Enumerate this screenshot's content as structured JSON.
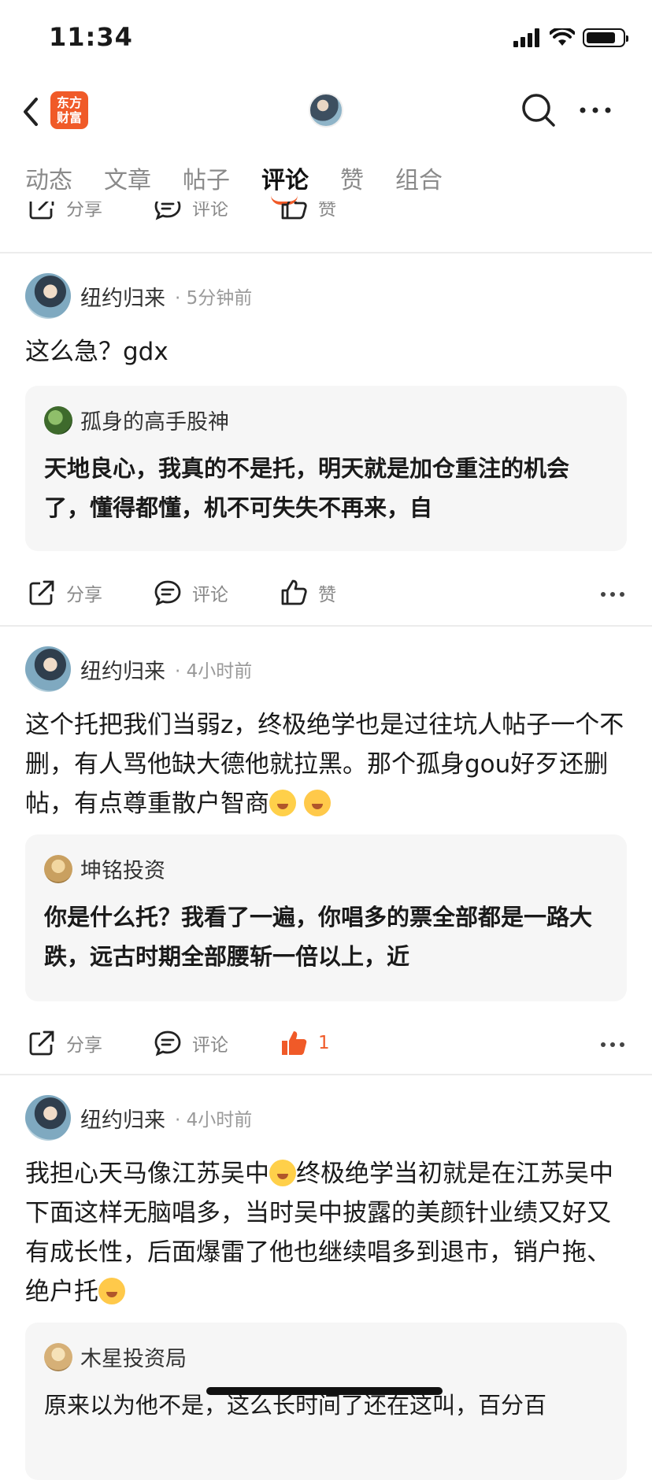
{
  "status_bar": {
    "time": "11:34"
  },
  "nav": {
    "brand_line1": "东方",
    "brand_line2": "财富"
  },
  "tabs": [
    {
      "label": "动态"
    },
    {
      "label": "文章"
    },
    {
      "label": "帖子"
    },
    {
      "label": "评论",
      "active": true
    },
    {
      "label": "赞"
    },
    {
      "label": "组合"
    }
  ],
  "actions": {
    "share": "分享",
    "comment": "评论",
    "like": "赞"
  },
  "posts": [
    {
      "author": "纽约归来",
      "time": "5分钟前",
      "body": "这么急？gdx",
      "quote_author": "孤身的高手股神",
      "quote_text": "天地良心，我真的不是托，明天就是加仓重注的机会了，懂得都懂，机不可失失不再来，自",
      "like_count": ""
    },
    {
      "author": "纽约归来",
      "time": "4小时前",
      "body": "这个托把我们当弱z，终极绝学也是过往坑人帖子一个不删，有人骂他缺大德他就拉黑。那个孤身gou好歹还删帖，有点尊重散户智商",
      "quote_author": "坤铭投资",
      "quote_text": "你是什么托？我看了一遍，你唱多的票全部都是一路大跌，远古时期全部腰斩一倍以上，近",
      "like_count": "1"
    },
    {
      "author": "纽约归来",
      "time": "4小时前",
      "body_part1": "我担心天马像江苏吴中",
      "body_part2": "终极绝学当初就是在江苏吴中下面这样无脑唱多，当时吴中披露的美颜针业绩又好又有成长性，后面爆雷了他也继续唱多到退市，销户拖、绝户托",
      "quote_author": "木星投资局",
      "quote_text": "原来以为他不是，这么长时间了还在这叫，百分百"
    }
  ],
  "colors": {
    "accent": "#f05a28",
    "divider": "#ececec",
    "quote_bg": "#f6f6f6"
  }
}
